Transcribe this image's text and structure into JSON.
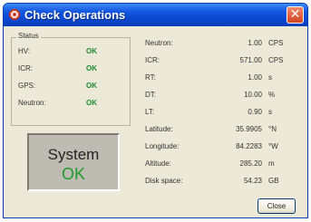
{
  "window": {
    "title": "Check Operations",
    "close_glyph": "✕"
  },
  "status": {
    "legend": "Status",
    "rows": [
      {
        "label": "HV:",
        "value": "OK"
      },
      {
        "label": "ICR:",
        "value": "OK"
      },
      {
        "label": "GPS:",
        "value": "OK"
      },
      {
        "label": "Neutron:",
        "value": "OK"
      }
    ]
  },
  "system": {
    "label": "System",
    "status": "OK"
  },
  "measurements": [
    {
      "label": "Neutron:",
      "value": "1.00",
      "unit": "CPS"
    },
    {
      "label": "ICR:",
      "value": "571.00",
      "unit": "CPS"
    },
    {
      "label": "RT:",
      "value": "1.00",
      "unit": "s"
    },
    {
      "label": "DT:",
      "value": "10.00",
      "unit": "%"
    },
    {
      "label": "LT:",
      "value": "0.90",
      "unit": "s"
    },
    {
      "label": "Latitude:",
      "value": "35.9905",
      "unit": "°N"
    },
    {
      "label": "Longitude:",
      "value": "84.2283",
      "unit": "°W"
    },
    {
      "label": "Altitude:",
      "value": "285.20",
      "unit": "m"
    },
    {
      "label": "Disk space:",
      "value": "54.23",
      "unit": "GB"
    }
  ],
  "buttons": {
    "close_label": "Close"
  },
  "colors": {
    "title_bar": "#0a46d0",
    "ok_green": "#1e8a2e",
    "dialog_bg": "#ece9d8"
  },
  "icons": {
    "app": "radiation-app-icon",
    "close": "close-icon"
  }
}
